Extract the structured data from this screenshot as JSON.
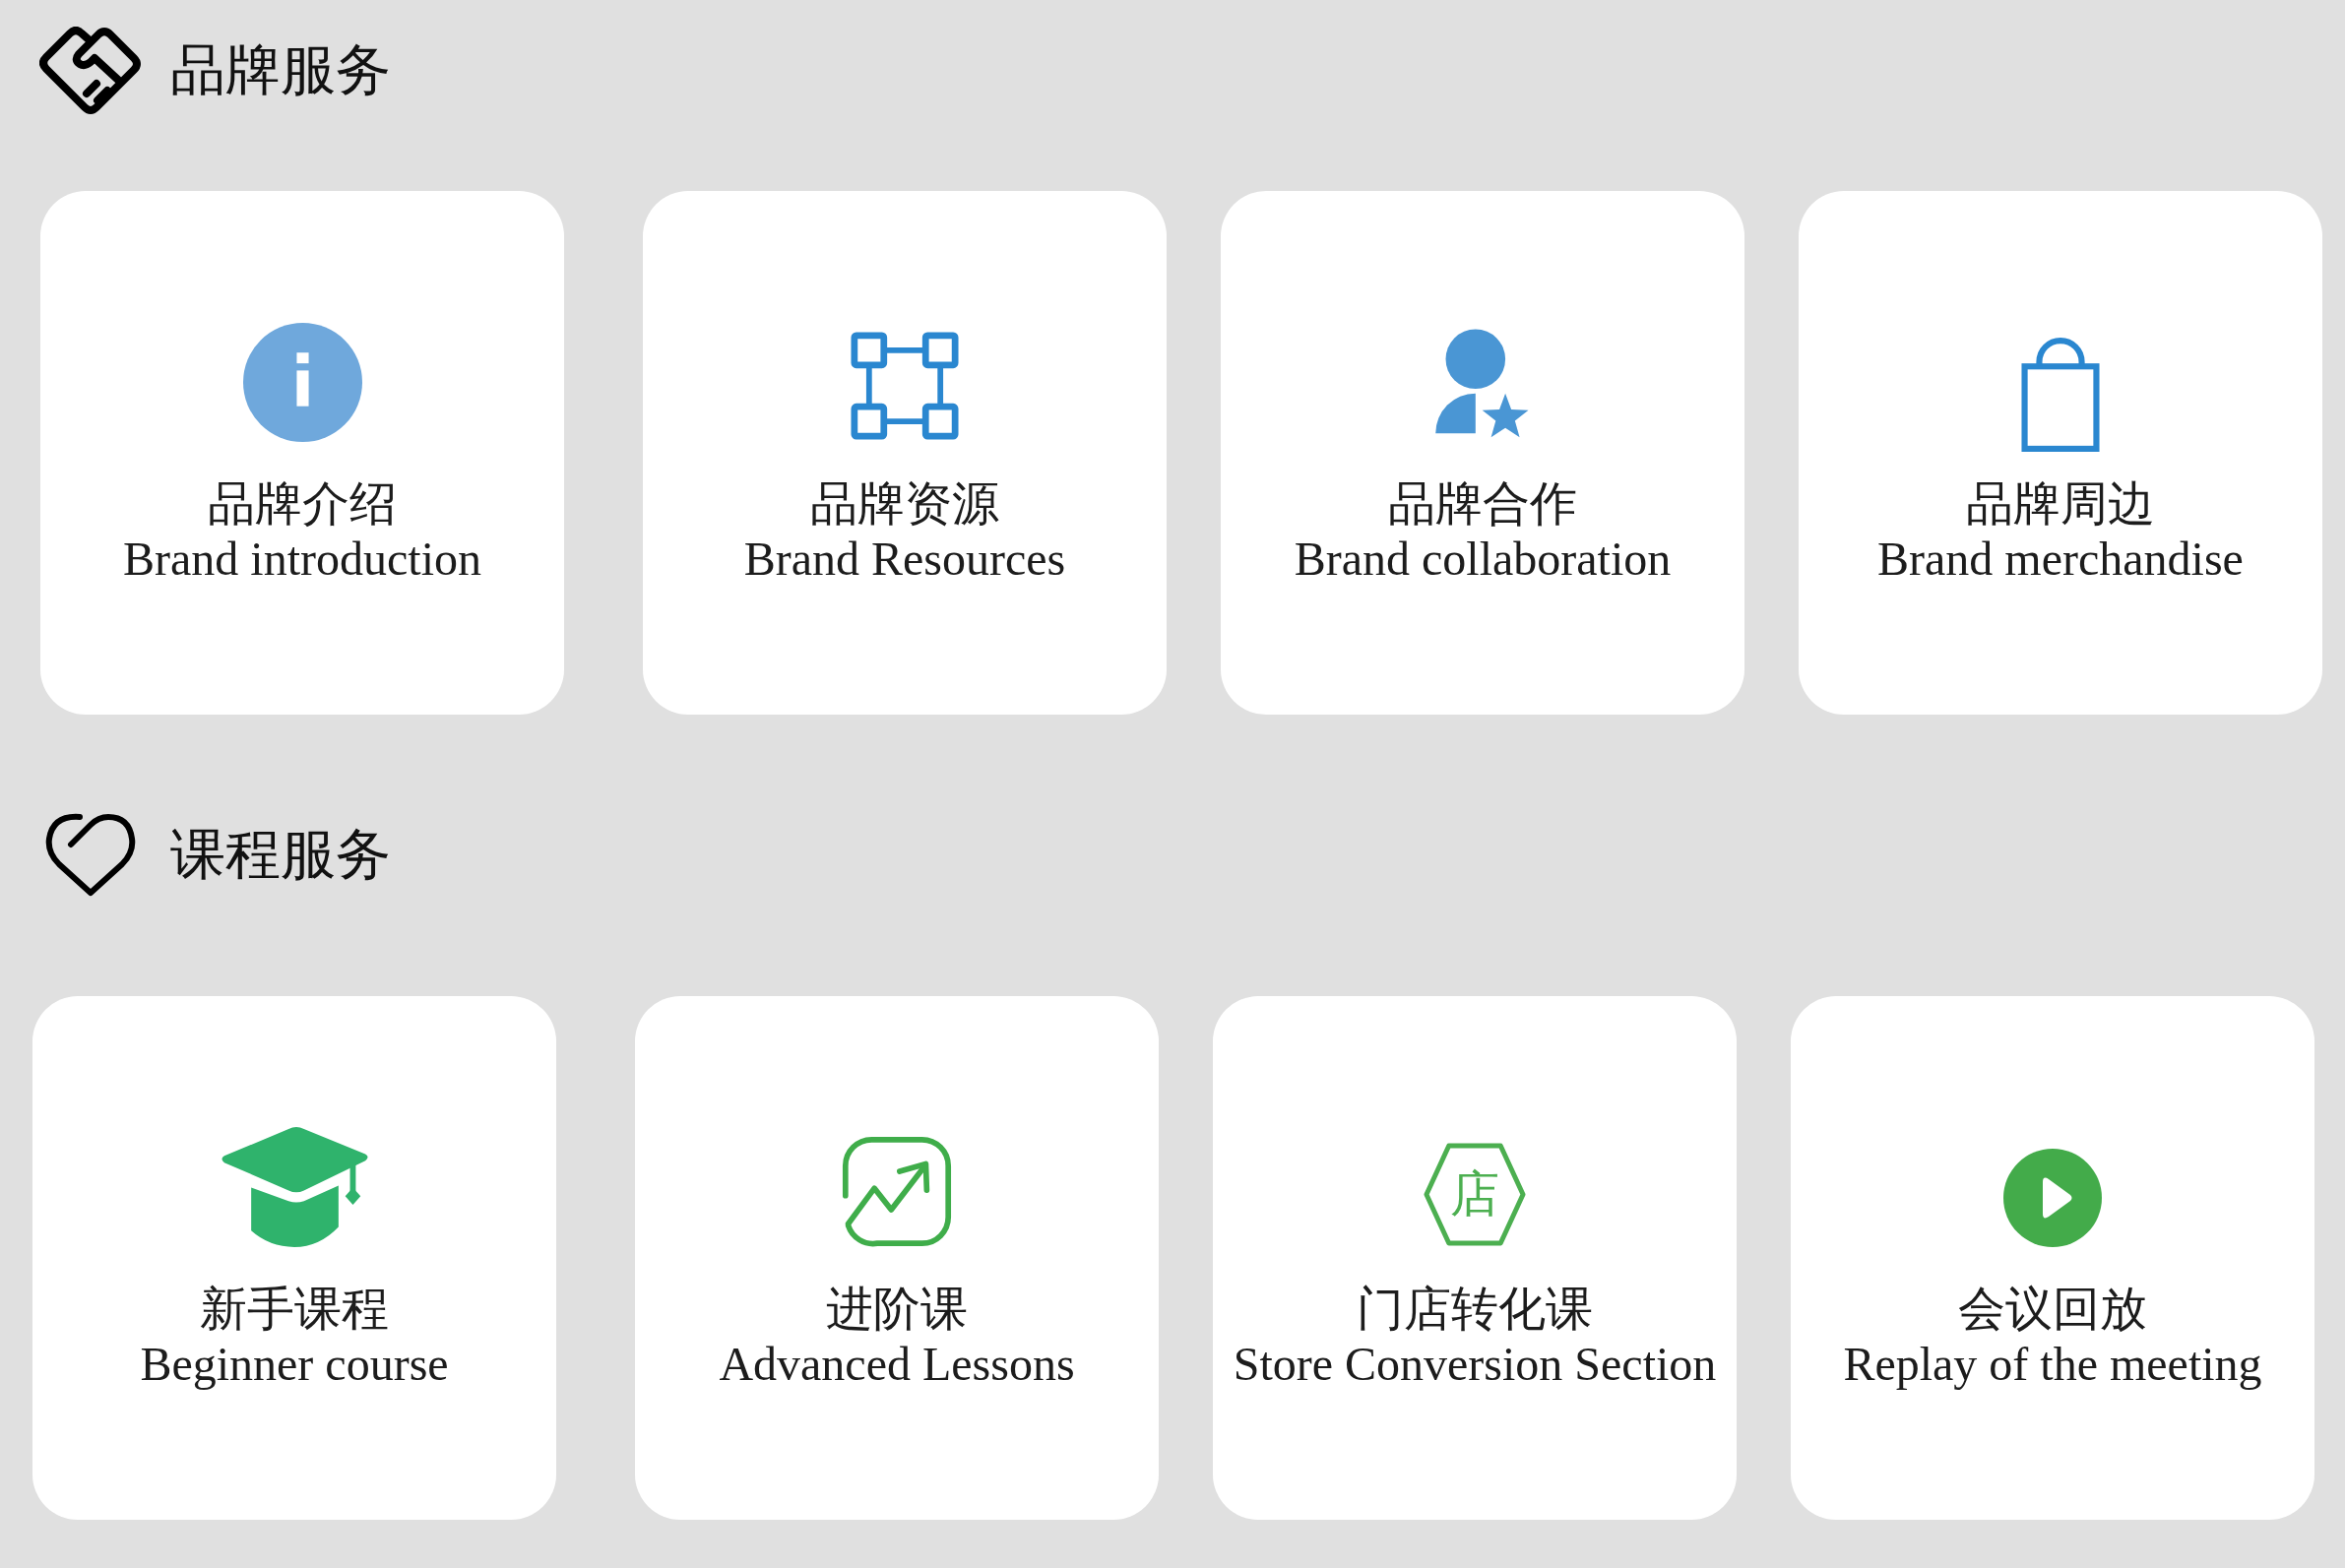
{
  "sections": [
    {
      "title": "品牌服务",
      "cards": [
        {
          "title": "品牌介绍",
          "subtitle": "Brand introduction"
        },
        {
          "title": "品牌资源",
          "subtitle": "Brand Resources"
        },
        {
          "title": "品牌合作",
          "subtitle": "Brand collaboration"
        },
        {
          "title": "品牌周边",
          "subtitle": "Brand merchandise"
        }
      ]
    },
    {
      "title": "课程服务",
      "cards": [
        {
          "title": "新手课程",
          "subtitle": "Beginner course"
        },
        {
          "title": "进阶课",
          "subtitle": "Advanced Lessons"
        },
        {
          "title": "门店转化课",
          "subtitle": "Store Conversion Section",
          "icon_glyph": "店"
        },
        {
          "title": "会议回放",
          "subtitle": "Replay of the meeting"
        }
      ]
    }
  ]
}
